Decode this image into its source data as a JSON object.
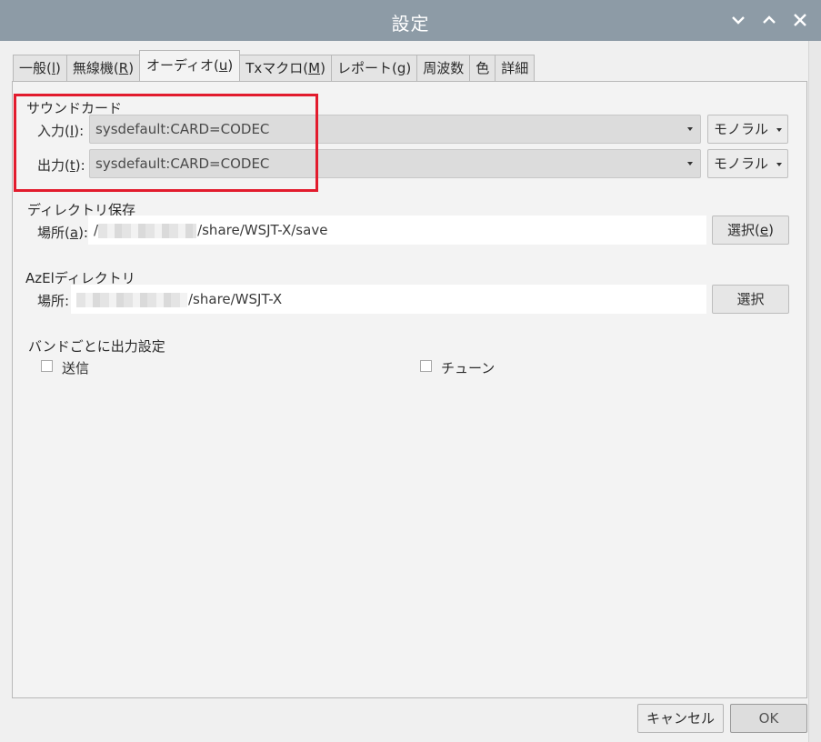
{
  "window": {
    "title": "設定",
    "controls": [
      "chevron-down",
      "chevron-up",
      "close"
    ]
  },
  "tabs": [
    {
      "prefix": "一般(",
      "key": "l",
      "suffix": ")",
      "active": false
    },
    {
      "prefix": "無線機(",
      "key": "R",
      "suffix": ")",
      "active": false
    },
    {
      "prefix": "オーディオ(",
      "key": "u",
      "suffix": ")",
      "active": true
    },
    {
      "prefix": "Txマクロ(",
      "key": "M",
      "suffix": ")",
      "active": false
    },
    {
      "prefix": "レポート(",
      "key": "g",
      "suffix": ")",
      "active": false
    },
    {
      "prefix": "周波数",
      "key": "",
      "suffix": "",
      "active": false
    },
    {
      "prefix": "色",
      "key": "",
      "suffix": "",
      "active": false
    },
    {
      "prefix": "詳細",
      "key": "",
      "suffix": "",
      "active": false
    }
  ],
  "soundcard": {
    "heading": "サウンドカード",
    "input": {
      "label_prefix": "入力(",
      "label_key": "I",
      "label_suffix": "):",
      "device": "sysdefault:CARD=CODEC",
      "channel": "モノラル"
    },
    "output": {
      "label_prefix": "出力(",
      "label_key": "t",
      "label_suffix": "):",
      "device": "sysdefault:CARD=CODEC",
      "channel": "モノラル"
    }
  },
  "save_dir": {
    "heading": "ディレクトリ保存",
    "label_prefix": "場所(",
    "label_key": "a",
    "label_suffix": "):",
    "path_prefix": "/",
    "path_suffix": "/share/WSJT-X/save",
    "button_prefix": "選択(",
    "button_key": "e",
    "button_suffix": ")"
  },
  "azel_dir": {
    "heading": "AzElディレクトリ",
    "label": "場所:",
    "path_suffix": "/share/WSJT-X",
    "button": "選択"
  },
  "band_output": {
    "heading": "バンドごとに出力設定",
    "transmit_label": "送信",
    "transmit_checked": false,
    "tune_label": "チューン",
    "tune_checked": false
  },
  "footer": {
    "cancel": "キャンセル",
    "ok": "OK"
  },
  "colors": {
    "titlebar": "#8d9ba6",
    "highlight": "#e21b2d"
  }
}
